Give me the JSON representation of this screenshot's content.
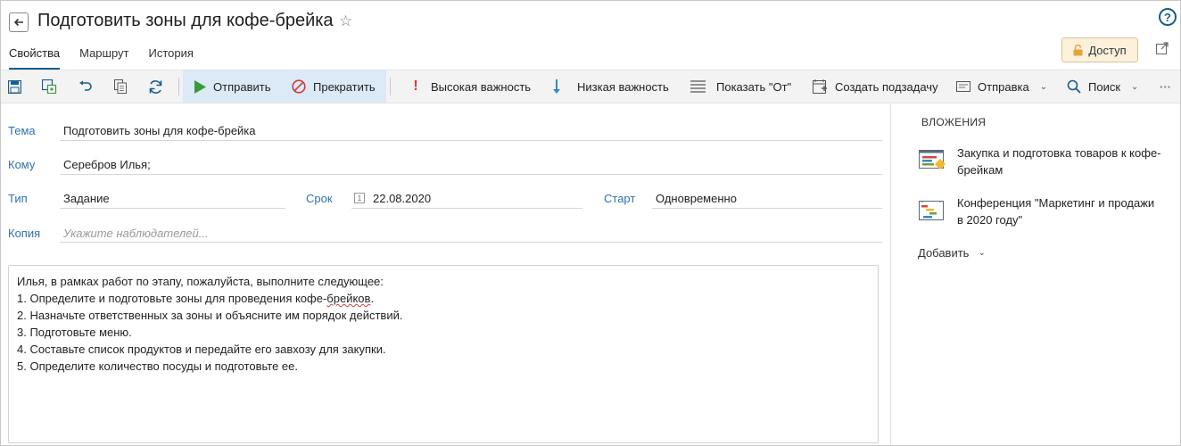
{
  "header": {
    "title": "Подготовить зоны для кофе-брейка",
    "back_icon": "arrow-left-icon",
    "favorite_icon": "star-outline-icon",
    "help_label": "?"
  },
  "tabs": [
    {
      "label": "Свойства",
      "active": true
    },
    {
      "label": "Маршрут",
      "active": false
    },
    {
      "label": "История",
      "active": false
    }
  ],
  "access_button": {
    "label": "Доступ",
    "icon": "lock-icon"
  },
  "toolbar": {
    "send": "Отправить",
    "stop": "Прекратить",
    "high_importance": "Высокая важность",
    "low_importance": "Низкая важность",
    "show_from": "Показать \"От\"",
    "create_subtask": "Создать подзадачу",
    "sending": "Отправка",
    "search": "Поиск",
    "more": "···"
  },
  "form": {
    "subject_label": "Тема",
    "subject_value": "Подготовить зоны для кофе-брейка",
    "to_label": "Кому",
    "to_value": "Серебров Илья;",
    "type_label": "Тип",
    "type_value": "Задание",
    "deadline_label": "Срок",
    "deadline_value": "22.08.2020",
    "start_label": "Старт",
    "start_value": "Одновременно",
    "cc_label": "Копия",
    "cc_placeholder": "Укажите наблюдателей..."
  },
  "body": {
    "intro": "Илья, в рамках работ по этапу, пожалуйста, выполните следующее:",
    "line1_before": "1. Определите и подготовьте зоны для проведения кофе-",
    "line1_misspelled": "брейков",
    "line1_after": ".",
    "line2": "2. Назначьте ответственных за зоны и объясните им порядок действий.",
    "line3": "3. Подготовьте меню.",
    "line4": "4. Составьте список продуктов и передайте его завхозу для закупки.",
    "line5": "5. Определите количество посуды и подготовьте ее."
  },
  "attachments": {
    "heading": "ВЛОЖЕНИЯ",
    "items": [
      {
        "label": "Закупка и подготовка товаров к кофе-брейкам",
        "icon": "chart-document-icon"
      },
      {
        "label": "Конференция \"Маркетинг и продажи в 2020 году\"",
        "icon": "gantt-document-icon"
      }
    ],
    "add_label": "Добавить"
  },
  "colors": {
    "accent": "#1a5d8c",
    "label_blue": "#2f73ad",
    "toolbar_bg": "#f3f3f3",
    "toolbar_highlight": "#dce9f6",
    "access_bg": "#fdf1dc",
    "send_green": "#3a9a3a",
    "stop_red": "#d23a3a"
  }
}
